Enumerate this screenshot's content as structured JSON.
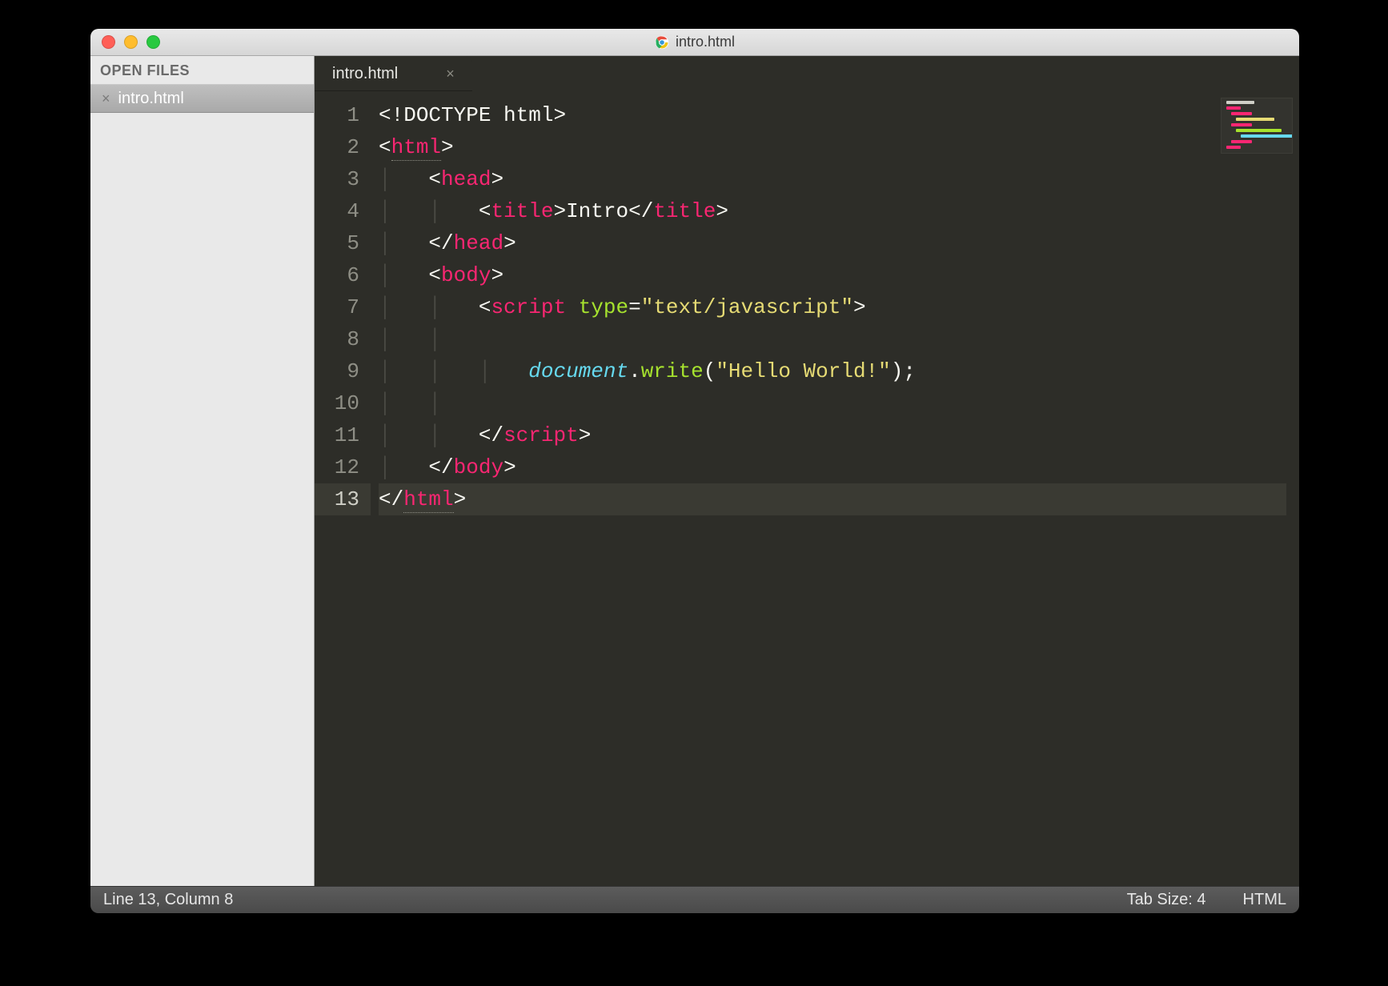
{
  "titlebar": {
    "title": "intro.html"
  },
  "sidebar": {
    "header": "OPEN FILES",
    "items": [
      {
        "name": "intro.html"
      }
    ]
  },
  "tabs": [
    {
      "label": "intro.html"
    }
  ],
  "editor": {
    "current_line": 13,
    "lines": [
      {
        "n": 1,
        "indent": 0,
        "tokens": [
          {
            "t": "<!",
            "c": "p"
          },
          {
            "t": "DOCTYPE html",
            "c": "p"
          },
          {
            "t": ">",
            "c": "p"
          }
        ]
      },
      {
        "n": 2,
        "indent": 0,
        "tokens": [
          {
            "t": "<",
            "c": "p"
          },
          {
            "t": "html",
            "c": "tg",
            "dotted": true
          },
          {
            "t": ">",
            "c": "p"
          }
        ]
      },
      {
        "n": 3,
        "indent": 1,
        "tokens": [
          {
            "t": "<",
            "c": "p"
          },
          {
            "t": "head",
            "c": "tg"
          },
          {
            "t": ">",
            "c": "p"
          }
        ]
      },
      {
        "n": 4,
        "indent": 2,
        "tokens": [
          {
            "t": "<",
            "c": "p"
          },
          {
            "t": "title",
            "c": "tg"
          },
          {
            "t": ">",
            "c": "p"
          },
          {
            "t": "Intro",
            "c": "p"
          },
          {
            "t": "</",
            "c": "p"
          },
          {
            "t": "title",
            "c": "tg"
          },
          {
            "t": ">",
            "c": "p"
          }
        ]
      },
      {
        "n": 5,
        "indent": 1,
        "tokens": [
          {
            "t": "</",
            "c": "p"
          },
          {
            "t": "head",
            "c": "tg"
          },
          {
            "t": ">",
            "c": "p"
          }
        ]
      },
      {
        "n": 6,
        "indent": 1,
        "tokens": [
          {
            "t": "<",
            "c": "p"
          },
          {
            "t": "body",
            "c": "tg"
          },
          {
            "t": ">",
            "c": "p"
          }
        ]
      },
      {
        "n": 7,
        "indent": 2,
        "tokens": [
          {
            "t": "<",
            "c": "p"
          },
          {
            "t": "script",
            "c": "tg"
          },
          {
            "t": " ",
            "c": "p"
          },
          {
            "t": "type",
            "c": "kw"
          },
          {
            "t": "=",
            "c": "p"
          },
          {
            "t": "\"text/javascript\"",
            "c": "str"
          },
          {
            "t": ">",
            "c": "p"
          }
        ]
      },
      {
        "n": 8,
        "indent": 2,
        "tokens": []
      },
      {
        "n": 9,
        "indent": 3,
        "tokens": [
          {
            "t": "document",
            "c": "obj"
          },
          {
            "t": ".",
            "c": "p"
          },
          {
            "t": "write",
            "c": "fn"
          },
          {
            "t": "(",
            "c": "p"
          },
          {
            "t": "\"Hello World!\"",
            "c": "str"
          },
          {
            "t": ");",
            "c": "p"
          }
        ]
      },
      {
        "n": 10,
        "indent": 2,
        "tokens": []
      },
      {
        "n": 11,
        "indent": 2,
        "tokens": [
          {
            "t": "</",
            "c": "p"
          },
          {
            "t": "script",
            "c": "tg"
          },
          {
            "t": ">",
            "c": "p"
          }
        ]
      },
      {
        "n": 12,
        "indent": 1,
        "tokens": [
          {
            "t": "</",
            "c": "p"
          },
          {
            "t": "body",
            "c": "tg"
          },
          {
            "t": ">",
            "c": "p"
          }
        ]
      },
      {
        "n": 13,
        "indent": 0,
        "tokens": [
          {
            "t": "</",
            "c": "p"
          },
          {
            "t": "html",
            "c": "tg",
            "dotted": true
          },
          {
            "t": ">",
            "c": "p"
          }
        ]
      }
    ]
  },
  "statusbar": {
    "position": "Line 13, Column 8",
    "tab_size": "Tab Size: 4",
    "syntax": "HTML"
  }
}
